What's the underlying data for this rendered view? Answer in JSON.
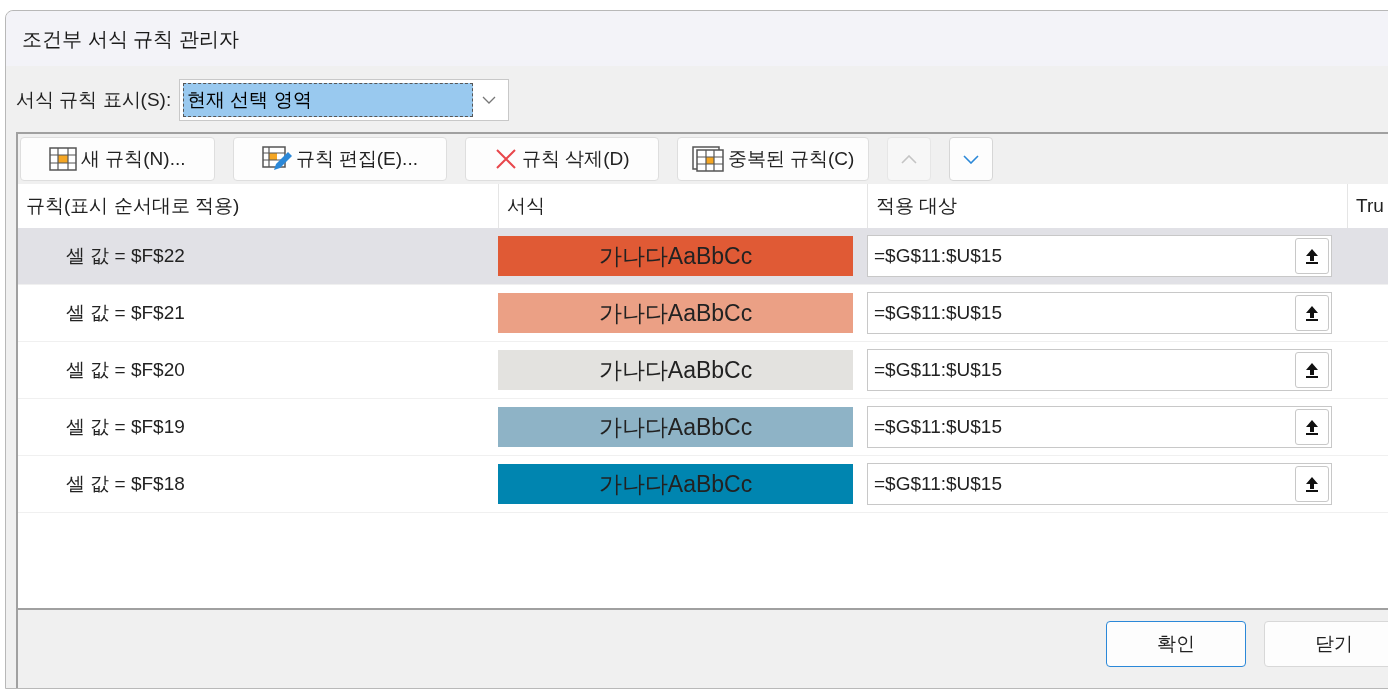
{
  "window": {
    "title": "조건부 서식 규칙 관리자"
  },
  "show_rules": {
    "label": "서식 규칙 표시(S):",
    "value": "현재 선택 영역"
  },
  "toolbar": [
    {
      "kind": "new",
      "label": "새 규칙(N)..."
    },
    {
      "kind": "edit",
      "label": "규칙 편집(E)..."
    },
    {
      "kind": "delete",
      "label": "규칙 삭제(D)"
    },
    {
      "kind": "duplicate",
      "label": "중복된 규칙(C)"
    },
    {
      "kind": "up",
      "disabled": true
    },
    {
      "kind": "down",
      "disabled": false
    }
  ],
  "table": {
    "columns": [
      "규칙(표시 순서대로 적용)",
      "서식",
      "적용 대상",
      "Tru"
    ],
    "rows": [
      {
        "rule": "셀 값 = $F$22",
        "preview": "가나다AaBbCc",
        "color": "#e05a35",
        "applies_to": "=$G$11:$U$15",
        "selected": true
      },
      {
        "rule": "셀 값 = $F$21",
        "preview": "가나다AaBbCc",
        "color": "#eba085",
        "applies_to": "=$G$11:$U$15",
        "selected": false
      },
      {
        "rule": "셀 값 = $F$20",
        "preview": "가나다AaBbCc",
        "color": "#e3e2df",
        "applies_to": "=$G$11:$U$15",
        "selected": false
      },
      {
        "rule": "셀 값 = $F$19",
        "preview": "가나다AaBbCc",
        "color": "#8eb3c6",
        "applies_to": "=$G$11:$U$15",
        "selected": false
      },
      {
        "rule": "셀 값 = $F$18",
        "preview": "가나다AaBbCc",
        "color": "#0085b0",
        "applies_to": "=$G$11:$U$15",
        "selected": false
      }
    ]
  },
  "buttons": [
    {
      "label": "확인",
      "default": true
    },
    {
      "label": "닫기",
      "default": false
    }
  ]
}
